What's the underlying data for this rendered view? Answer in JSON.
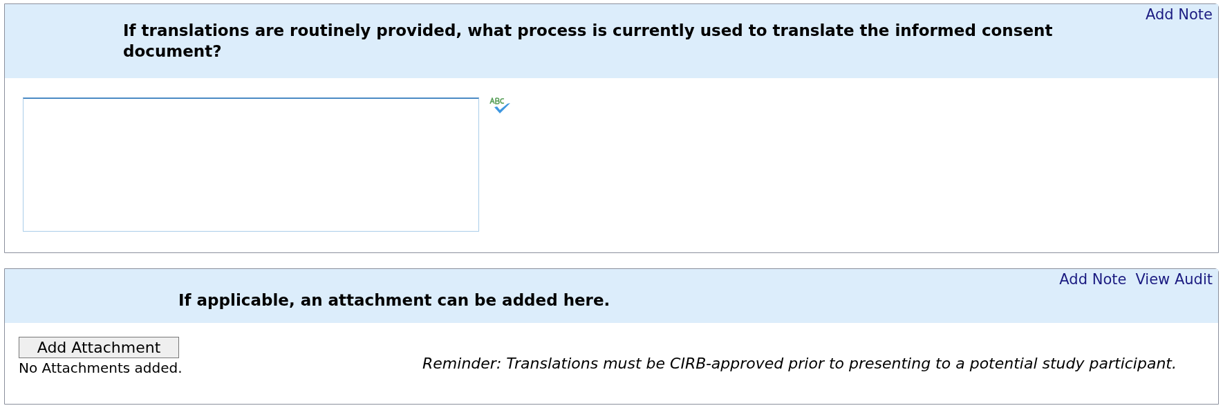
{
  "sections": [
    {
      "kind": "text",
      "question": "If translations are routinely provided, what process is currently used to translate the informed consent document?",
      "links": [
        "Add Note"
      ]
    },
    {
      "kind": "attachment",
      "question": "If applicable, an attachment can be added here.",
      "links": [
        "Add Note",
        "View Audit"
      ],
      "button": "Add Attachment",
      "status": "No Attachments added.",
      "reminder": "Reminder: Translations must be CIRB-approved prior to presenting to a potential study participant."
    }
  ]
}
